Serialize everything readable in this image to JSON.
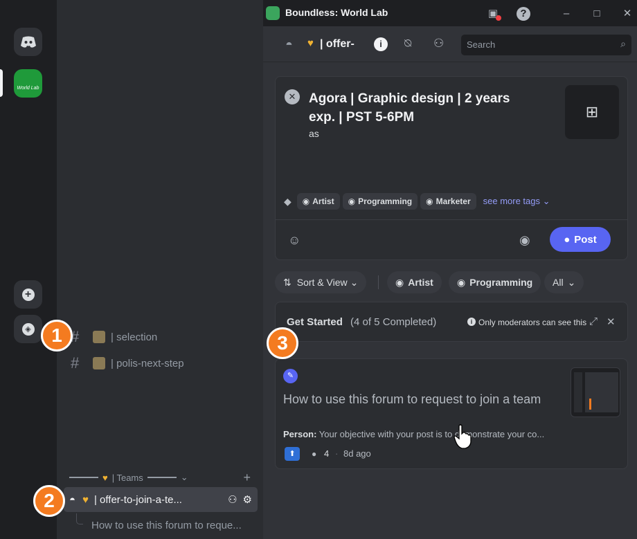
{
  "window": {
    "title": "Boundless: World Lab"
  },
  "rail": {
    "server_name": "World Lab"
  },
  "channels": {
    "items": [
      {
        "label": "| selection"
      },
      {
        "label": "| polis-next-step"
      }
    ],
    "category": "| Teams",
    "forum": {
      "label": "| offer-to-join-a-te..."
    },
    "thread": {
      "label": "How to use this forum to reque..."
    }
  },
  "header": {
    "channel": "| offer-",
    "search_placeholder": "Search"
  },
  "composer": {
    "title": "Agora | Graphic design | 2 years exp. | PST 5-6PM",
    "body": "as",
    "tags": [
      "Artist",
      "Programming",
      "Marketer"
    ],
    "see_more": "see more tags",
    "post_label": "Post"
  },
  "filters": {
    "sort_label": "Sort & View",
    "tags": [
      "Artist",
      "Programming"
    ],
    "all_label": "All"
  },
  "get_started": {
    "title": "Get Started",
    "progress": "(4 of 5 Completed)",
    "note": "Only moderators can see this"
  },
  "post": {
    "title": "How to use this forum to request to join a team",
    "author": "Person:",
    "preview": "Your objective with your post is to demonstrate your co...",
    "replies": "4",
    "age": "8d ago"
  },
  "callouts": [
    "1",
    "2",
    "3"
  ],
  "colors": {
    "accent": "#5865f2",
    "callout": "#f47b20"
  }
}
